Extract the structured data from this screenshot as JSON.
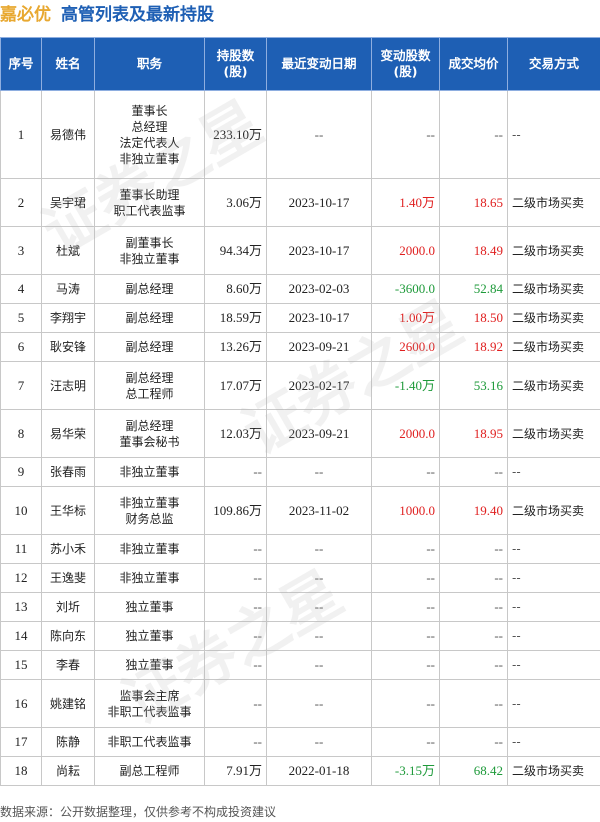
{
  "title": {
    "company": "嘉必优",
    "subtitle": "高管列表及最新持股"
  },
  "headers": [
    "序号",
    "姓名",
    "职务",
    "持股数\n(股)",
    "最近变动日期",
    "变动股数\n(股)",
    "成交均价",
    "交易方式"
  ],
  "rows": [
    {
      "no": "1",
      "name": "易德伟",
      "role": [
        "董事长",
        "总经理",
        "法定代表人",
        "非独立董事"
      ],
      "shares": "233.10万",
      "date": "--",
      "change": "--",
      "price": "--",
      "method": "--",
      "dir": "none"
    },
    {
      "no": "2",
      "name": "吴宇珺",
      "role": [
        "董事长助理",
        "职工代表监事"
      ],
      "shares": "3.06万",
      "date": "2023-10-17",
      "change": "1.40万",
      "price": "18.65",
      "method": "二级市场买卖",
      "dir": "pos"
    },
    {
      "no": "3",
      "name": "杜斌",
      "role": [
        "副董事长",
        "非独立董事"
      ],
      "shares": "94.34万",
      "date": "2023-10-17",
      "change": "2000.0",
      "price": "18.49",
      "method": "二级市场买卖",
      "dir": "pos"
    },
    {
      "no": "4",
      "name": "马涛",
      "role": [
        "副总经理"
      ],
      "shares": "8.60万",
      "date": "2023-02-03",
      "change": "-3600.0",
      "price": "52.84",
      "method": "二级市场买卖",
      "dir": "neg"
    },
    {
      "no": "5",
      "name": "李翔宇",
      "role": [
        "副总经理"
      ],
      "shares": "18.59万",
      "date": "2023-10-17",
      "change": "1.00万",
      "price": "18.50",
      "method": "二级市场买卖",
      "dir": "pos"
    },
    {
      "no": "6",
      "name": "耿安锋",
      "role": [
        "副总经理"
      ],
      "shares": "13.26万",
      "date": "2023-09-21",
      "change": "2600.0",
      "price": "18.92",
      "method": "二级市场买卖",
      "dir": "pos"
    },
    {
      "no": "7",
      "name": "汪志明",
      "role": [
        "副总经理",
        "总工程师"
      ],
      "shares": "17.07万",
      "date": "2023-02-17",
      "change": "-1.40万",
      "price": "53.16",
      "method": "二级市场买卖",
      "dir": "neg"
    },
    {
      "no": "8",
      "name": "易华荣",
      "role": [
        "副总经理",
        "董事会秘书"
      ],
      "shares": "12.03万",
      "date": "2023-09-21",
      "change": "2000.0",
      "price": "18.95",
      "method": "二级市场买卖",
      "dir": "pos"
    },
    {
      "no": "9",
      "name": "张春雨",
      "role": [
        "非独立董事"
      ],
      "shares": "--",
      "date": "--",
      "change": "--",
      "price": "--",
      "method": "--",
      "dir": "none"
    },
    {
      "no": "10",
      "name": "王华标",
      "role": [
        "非独立董事",
        "财务总监"
      ],
      "shares": "109.86万",
      "date": "2023-11-02",
      "change": "1000.0",
      "price": "19.40",
      "method": "二级市场买卖",
      "dir": "pos"
    },
    {
      "no": "11",
      "name": "苏小禾",
      "role": [
        "非独立董事"
      ],
      "shares": "--",
      "date": "--",
      "change": "--",
      "price": "--",
      "method": "--",
      "dir": "none"
    },
    {
      "no": "12",
      "name": "王逸斐",
      "role": [
        "非独立董事"
      ],
      "shares": "--",
      "date": "--",
      "change": "--",
      "price": "--",
      "method": "--",
      "dir": "none"
    },
    {
      "no": "13",
      "name": "刘圻",
      "role": [
        "独立董事"
      ],
      "shares": "--",
      "date": "--",
      "change": "--",
      "price": "--",
      "method": "--",
      "dir": "none"
    },
    {
      "no": "14",
      "name": "陈向东",
      "role": [
        "独立董事"
      ],
      "shares": "--",
      "date": "--",
      "change": "--",
      "price": "--",
      "method": "--",
      "dir": "none"
    },
    {
      "no": "15",
      "name": "李春",
      "role": [
        "独立董事"
      ],
      "shares": "--",
      "date": "--",
      "change": "--",
      "price": "--",
      "method": "--",
      "dir": "none"
    },
    {
      "no": "16",
      "name": "姚建铭",
      "role": [
        "监事会主席",
        "非职工代表监事"
      ],
      "shares": "--",
      "date": "--",
      "change": "--",
      "price": "--",
      "method": "--",
      "dir": "none"
    },
    {
      "no": "17",
      "name": "陈静",
      "role": [
        "非职工代表监事"
      ],
      "shares": "--",
      "date": "--",
      "change": "--",
      "price": "--",
      "method": "--",
      "dir": "none"
    },
    {
      "no": "18",
      "name": "尚耘",
      "role": [
        "副总工程师"
      ],
      "shares": "7.91万",
      "date": "2022-01-18",
      "change": "-3.15万",
      "price": "68.42",
      "method": "二级市场买卖",
      "dir": "neg"
    }
  ],
  "footer": "数据来源：公开数据整理，仅供参考不构成投资建议",
  "colors": {
    "header_bg": "#1e5fb4",
    "company": "#e8a830",
    "subtitle": "#1e5fb4",
    "positive": "#e02020",
    "negative": "#1e9a3a"
  }
}
